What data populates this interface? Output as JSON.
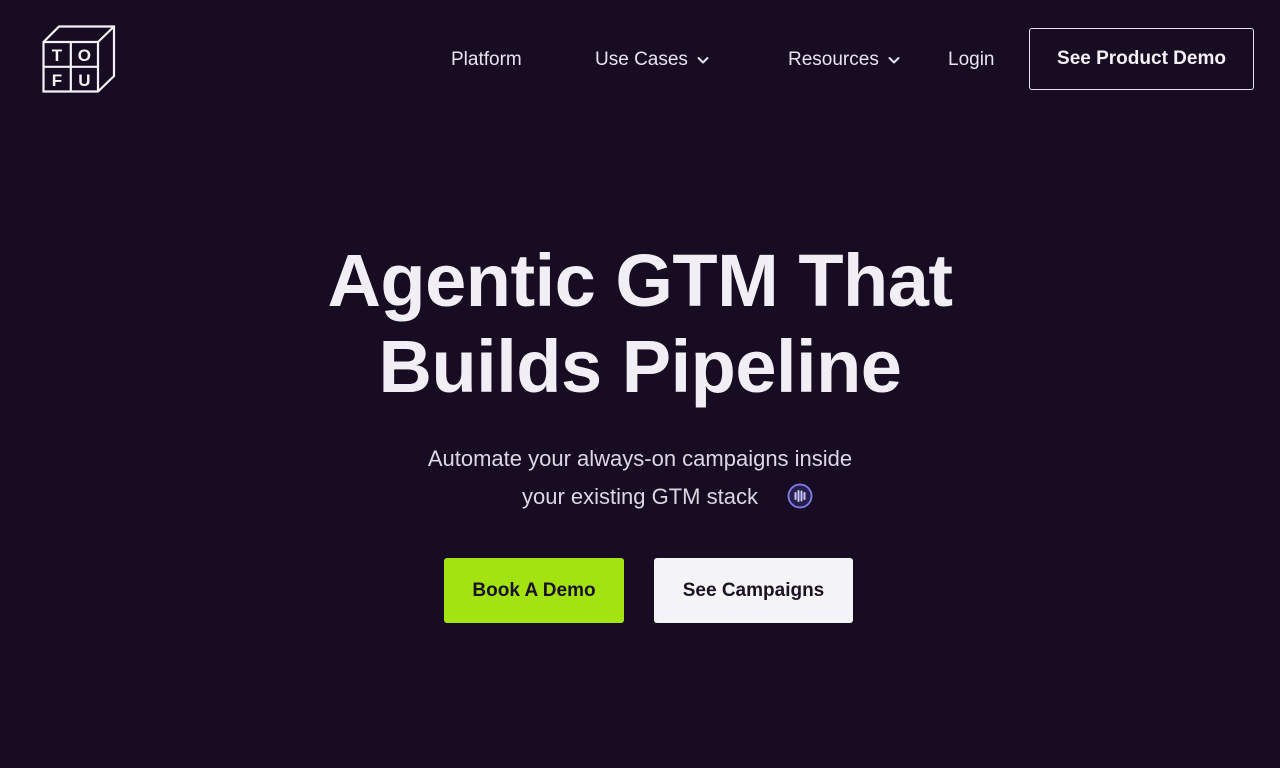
{
  "header": {
    "logo_letters": [
      "T",
      "O",
      "F",
      "U"
    ],
    "nav": {
      "platform": "Platform",
      "use_cases": "Use Cases",
      "resources": "Resources",
      "login": "Login"
    },
    "cta_label": "See Product Demo"
  },
  "hero": {
    "title_line1": "Agentic GTM That",
    "title_line2": "Builds Pipeline",
    "subtitle_line1": "Automate your always-on campaigns inside",
    "subtitle_line2": "your existing GTM stack",
    "primary_button": "Book A Demo",
    "secondary_button": "See Campaigns"
  },
  "icons": {
    "logo": "tofu-logo-icon",
    "dropdown": "chevron-down-icon",
    "audio": "sound-wave-icon"
  },
  "colors": {
    "background": "#170c22",
    "accent": "#a3e312",
    "text": "#f1edf4",
    "audio_icon": "#7f7ff0"
  }
}
